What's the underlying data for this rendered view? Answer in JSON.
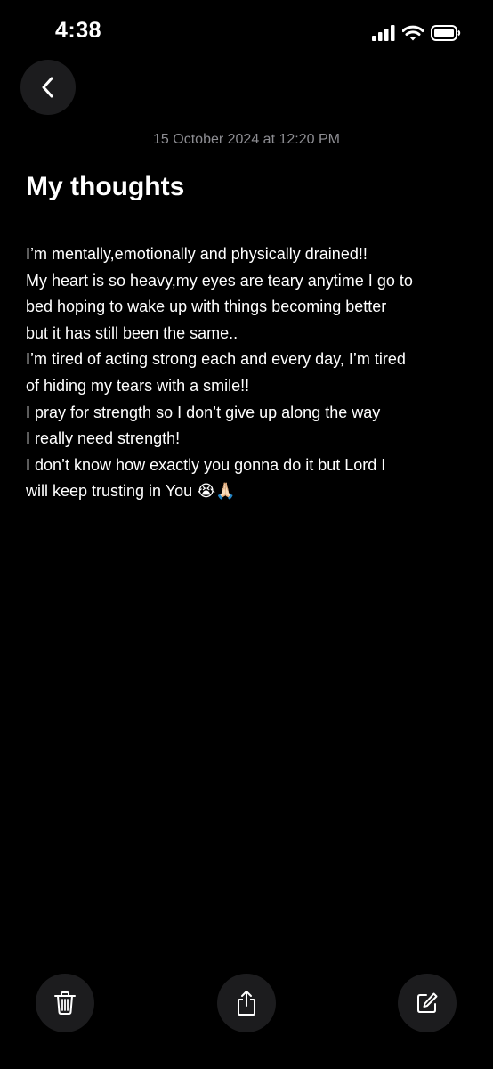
{
  "status_bar": {
    "time": "4:38",
    "icons": [
      "cellular-signal-icon",
      "wifi-icon",
      "battery-icon"
    ]
  },
  "navigation": {
    "back_icon": "chevron-left-icon"
  },
  "note": {
    "date": "15 October 2024 at 12:20 PM",
    "title": "My thoughts",
    "body_lines": [
      "I’m mentally,emotionally and physically drained!!",
      "My heart is so heavy,my eyes are teary anytime I go to",
      "bed hoping to wake up with things becoming better",
      "but it has still been the same..",
      "I’m tired of acting strong each and every day, I’m tired",
      "of hiding my tears with a smile!!",
      "I pray for strength so I don’t give up along the way",
      "I really need strength!",
      "I don’t know how exactly you gonna do it but Lord I",
      "will keep trusting in You 😭🙏🏻"
    ]
  },
  "toolbar": {
    "buttons": [
      "trash-icon",
      "share-icon",
      "compose-icon"
    ]
  },
  "colors": {
    "background": "#000000",
    "button_background": "#1c1c1e",
    "text_primary": "#ffffff",
    "text_secondary": "#8e8e93"
  }
}
